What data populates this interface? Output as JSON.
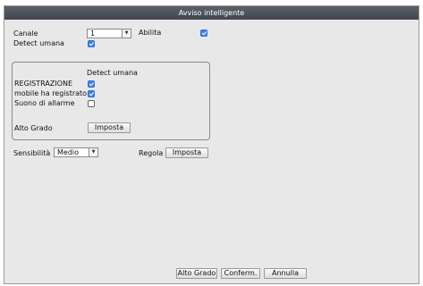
{
  "window": {
    "title": "Avviso intelligente"
  },
  "top": {
    "channel_label": "Canale",
    "channel_value": "1",
    "enable_label": "Abilita",
    "enable_checked": true,
    "detect_label": "Detect umana",
    "detect_checked": true
  },
  "group": {
    "header": "Detect umana",
    "items": [
      {
        "label": "REGISTRAZIONE",
        "checked": true
      },
      {
        "label": "mobile ha registrato",
        "checked": true
      },
      {
        "label": "Suono di allarme",
        "checked": false
      }
    ],
    "alto_grado_label": "Alto Grado",
    "set_button": "Imposta"
  },
  "sensitivity": {
    "label": "Sensibilità",
    "value": "Medio",
    "regola_label": "Regola",
    "set_button": "Imposta"
  },
  "footer": {
    "alto_grado_button": "Alto Grado",
    "confirm_button": "Conferm.",
    "cancel_button": "Annulla"
  },
  "colors": {
    "checkbox_on": "#3b82e6",
    "titlebar": "#4b5058"
  },
  "icons": {
    "dropdown": "chevron-down-icon",
    "check": "check-icon"
  }
}
